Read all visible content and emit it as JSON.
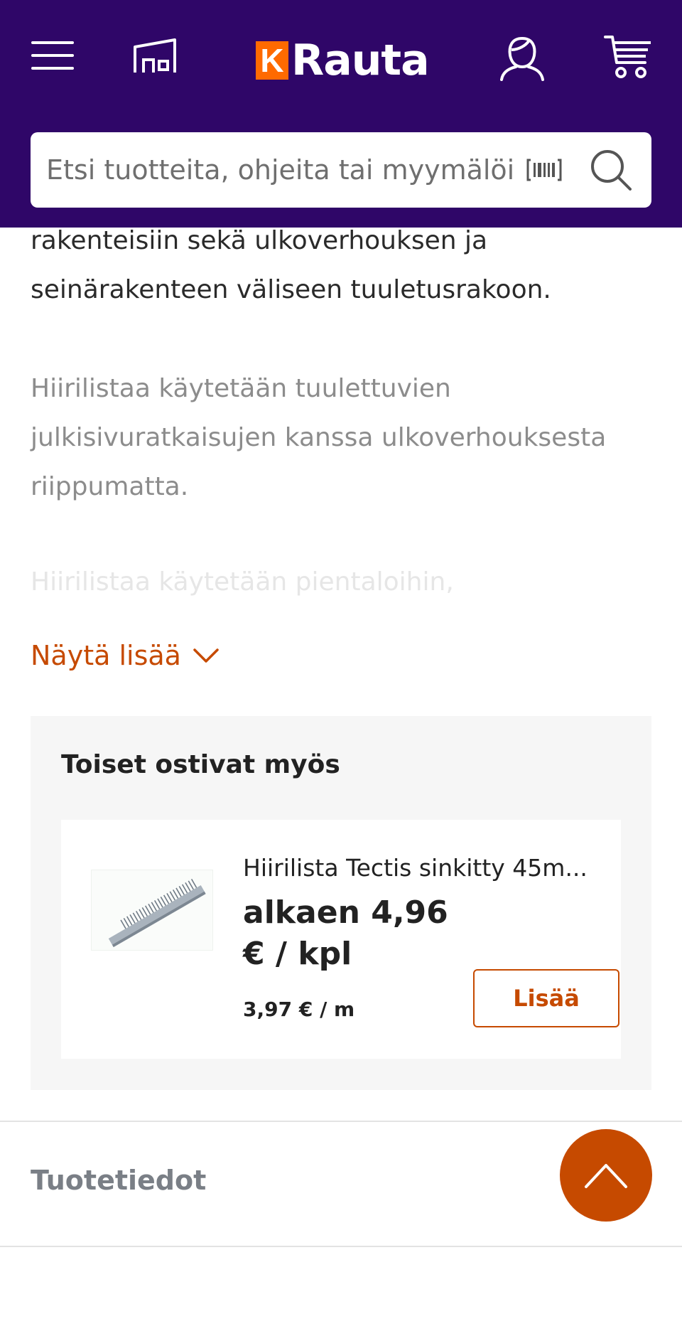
{
  "header": {
    "logo_letter": "K",
    "logo_word": "Rauta",
    "icons": [
      "menu-icon",
      "store-icon",
      "account-icon",
      "cart-icon"
    ],
    "brand_color": "#2f0668",
    "accent_color": "#ff6a00"
  },
  "search": {
    "placeholder": "Etsi tuotteita, ohjeita tai myymälöitä",
    "value": ""
  },
  "description": {
    "paragraph_1": "rakenteisiin sekä ulkoverhouksen ja seinärakenteen väliseen tuuletusrakoon.",
    "paragraph_2": "Hiirilistaa käytetään tuulettuvien julkisivuratkaisujen kanssa ulkoverhouksesta riippumatta.",
    "paragraph_3": "Hiirilistaa käytetään pientaloihin,",
    "show_more_label": "Näytä lisää"
  },
  "recommendations": {
    "title": "Toiset ostivat myös",
    "items": [
      {
        "name": "Hiirilista Tectis sinkitty 45m...",
        "price_line_1": "alkaen 4,96",
        "price_line_2": "€ / kpl",
        "unit_price": "3,97 € / m",
        "add_label": "Lisää"
      }
    ]
  },
  "product_info": {
    "section_title": "Tuotetiedot"
  },
  "colors": {
    "action": "#c64a00"
  }
}
